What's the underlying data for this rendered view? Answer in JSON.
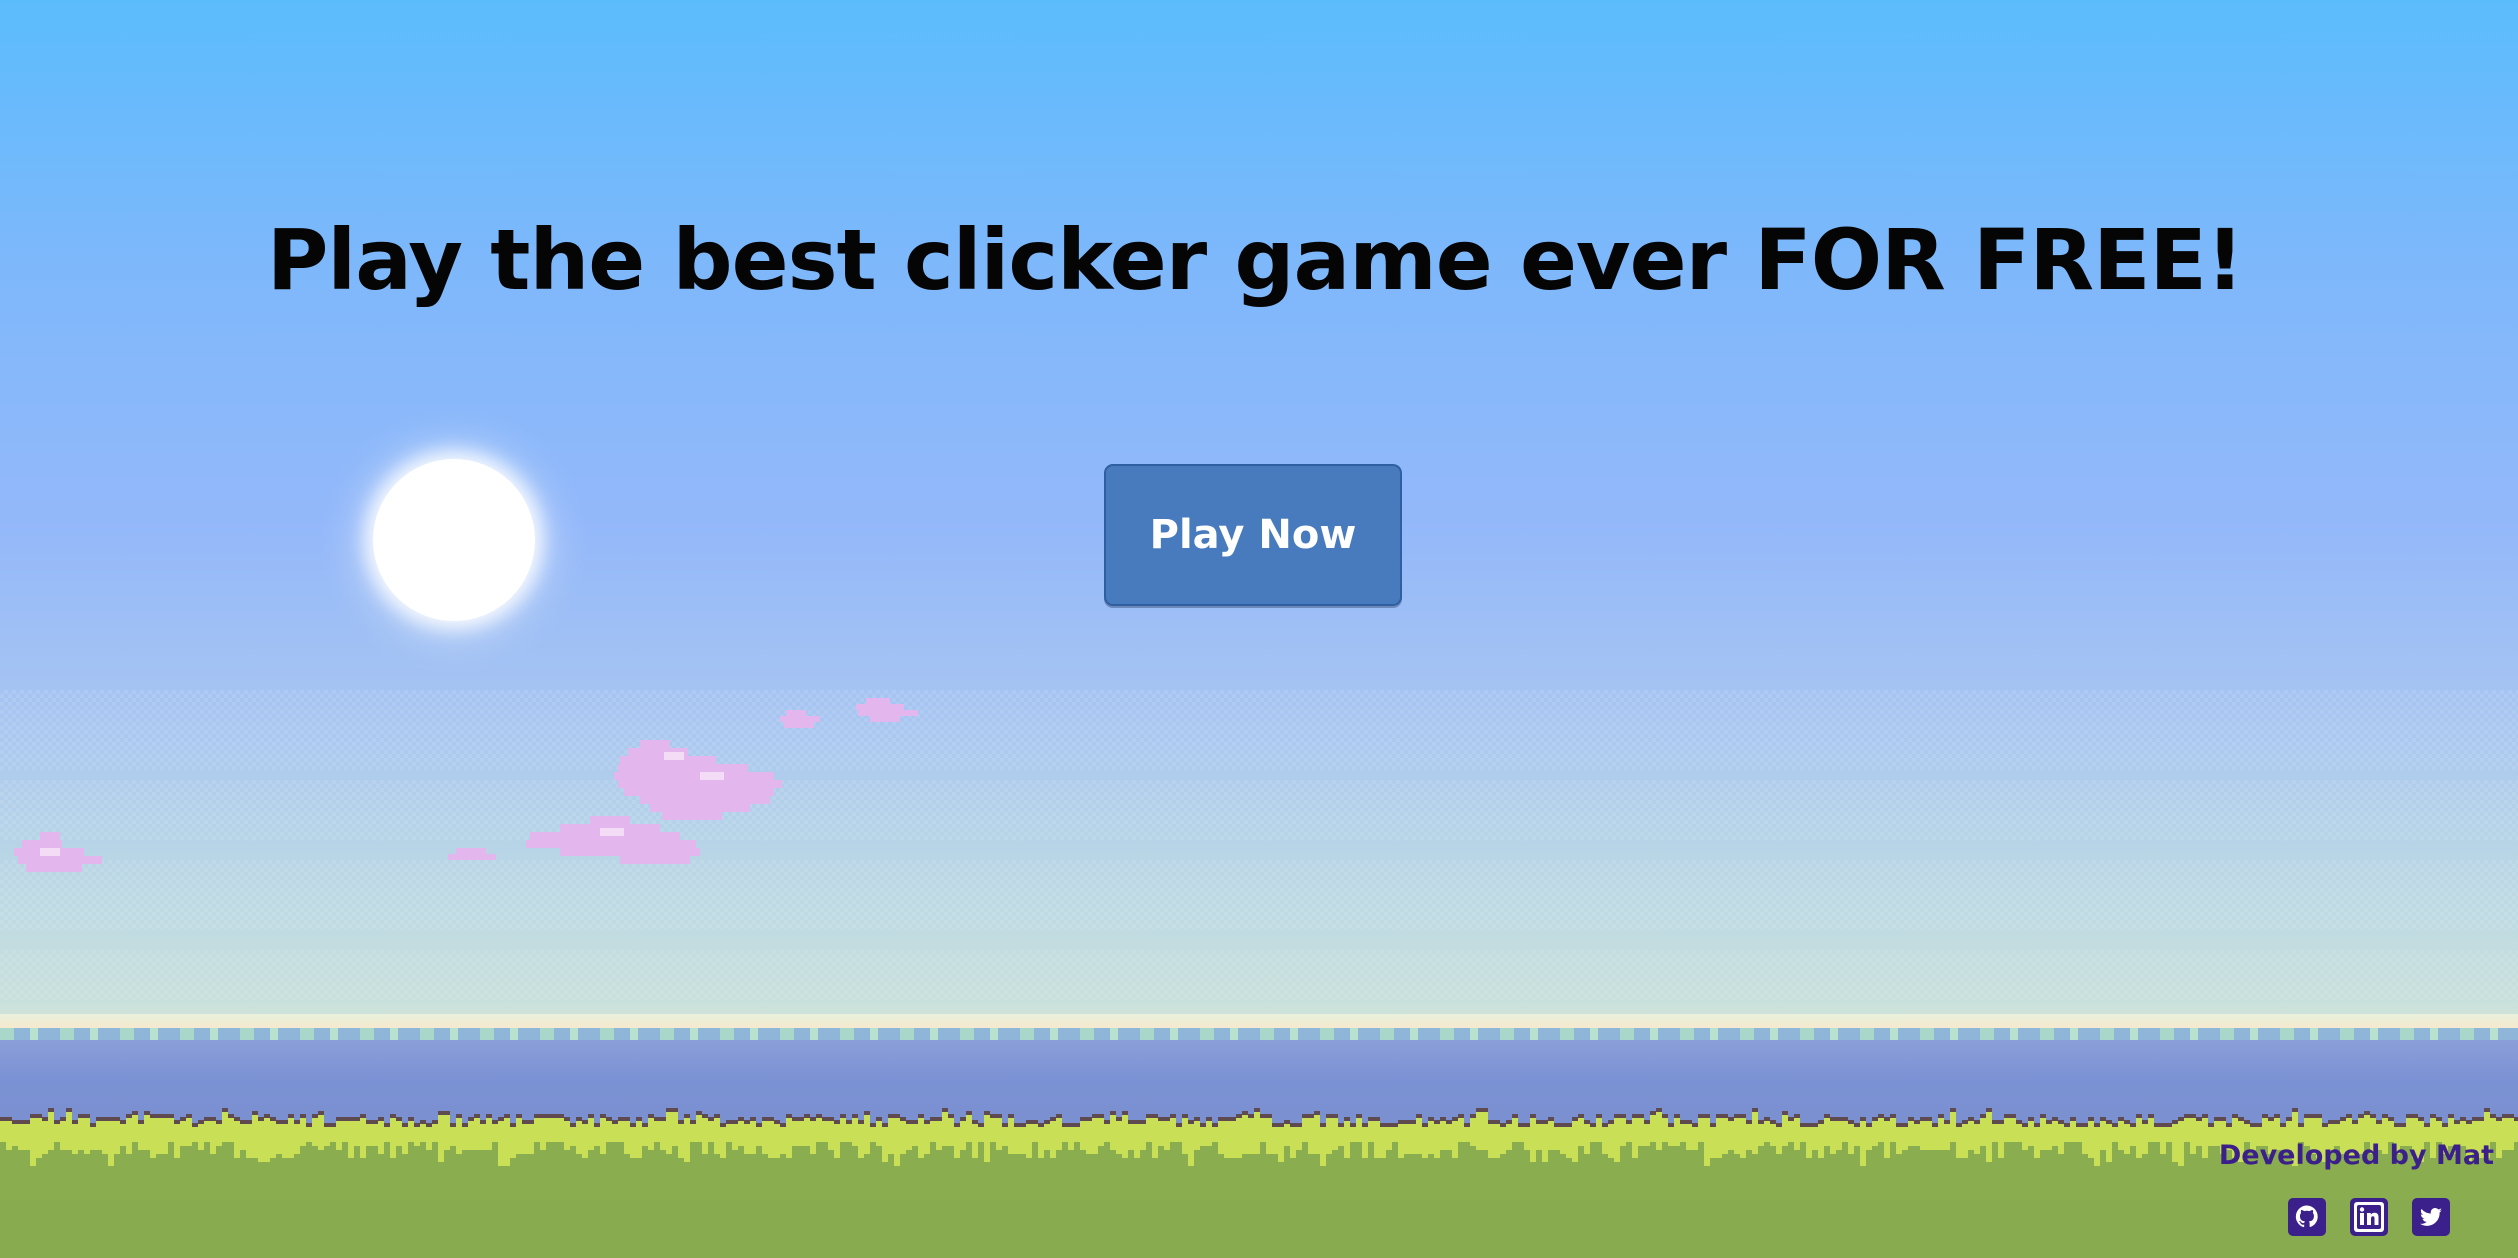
{
  "hero": {
    "headline": "Play the best clicker game ever FOR FREE!",
    "play_button_label": "Play Now"
  },
  "footer": {
    "credit": "Developed by Mat",
    "social_links": [
      {
        "icon": "github-icon"
      },
      {
        "icon": "linkedin-icon"
      },
      {
        "icon": "twitter-icon"
      }
    ]
  },
  "colors": {
    "sky_top": "#5bbcfc",
    "sky_mid": "#93b8fa",
    "button_bg": "#477bbd",
    "headline_text": "#050505",
    "footer_text": "#3b1f8a",
    "grass_light": "#c7df57",
    "grass_dark": "#88ab4f",
    "sea": "#7b90d0",
    "cloud": "#e6b8ef"
  }
}
